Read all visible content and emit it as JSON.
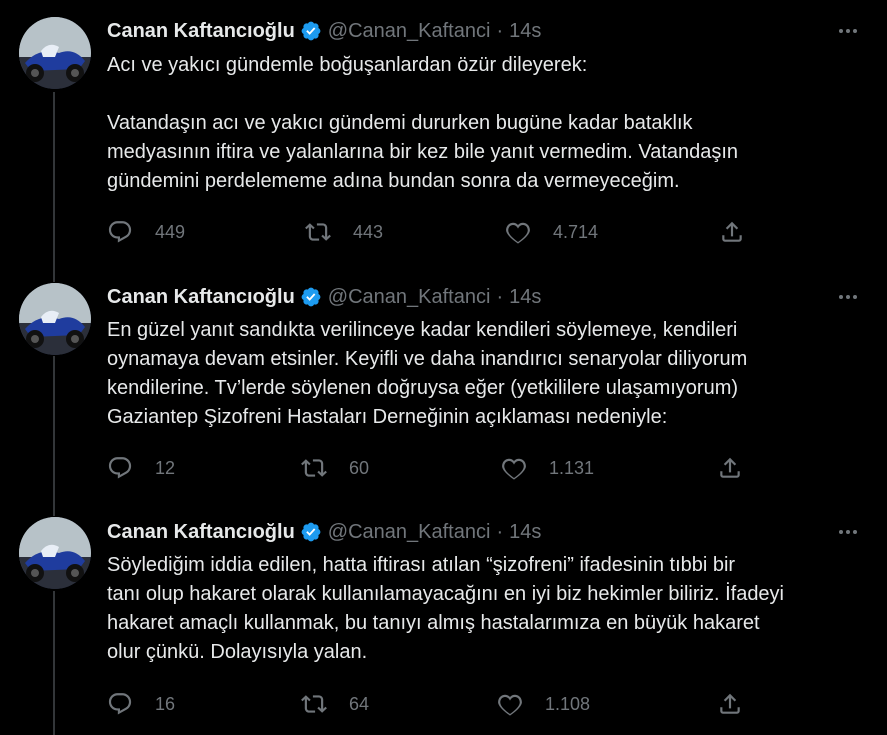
{
  "tweets": [
    {
      "author": "Canan Kaftancıoğlu",
      "handle": "@Canan_Kaftanci",
      "separator": "·",
      "time": "14s",
      "text": "Acı ve yakıcı gündemle boğuşanlardan özür dileyerek:\n\nVatandaşın acı ve yakıcı gündemi dururken bugüne kadar bataklık\nmedyasının iftira ve yalanlarına bir kez bile yanıt vermedim. Vatandaşın\ngündemini perdelememe adına bundan sonra da vermeyeceğim.",
      "replies": "449",
      "retweets": "443",
      "likes": "4.714"
    },
    {
      "author": "Canan Kaftancıoğlu",
      "handle": "@Canan_Kaftanci",
      "separator": "·",
      "time": "14s",
      "text": "En güzel yanıt sandıkta verilinceye kadar kendileri söylemeye, kendileri\noynamaya devam etsinler. Keyifli ve daha inandırıcı senaryolar diliyorum\nkendilerine. Tv’lerde söylenen doğruysa eğer (yetkililere ulaşamıyorum)\nGaziantep Şizofreni Hastaları Derneğinin açıklaması nedeniyle:",
      "replies": "12",
      "retweets": "60",
      "likes": "1.131"
    },
    {
      "author": "Canan Kaftancıoğlu",
      "handle": "@Canan_Kaftanci",
      "separator": "·",
      "time": "14s",
      "text": "Söylediğim iddia edilen, hatta iftirası atılan “şizofreni” ifadesinin tıbbi bir\ntanı olup hakaret olarak kullanılamayacağını en iyi biz hekimler biliriz. İfadeyi\nhakaret amaçlı kullanmak, bu tanıyı almış hastalarımıza en büyük hakaret\nolur çünkü. Dolayısıyla yalan.",
      "replies": "16",
      "retweets": "64",
      "likes": "1.108"
    }
  ],
  "colors": {
    "background": "#000000",
    "text": "#e7e9ea",
    "muted": "#71767b",
    "verified": "#1d9bf0",
    "thread_line": "#333639"
  },
  "icons": {
    "reply": "reply-icon",
    "retweet": "retweet-icon",
    "like": "like-icon",
    "share": "share-icon",
    "more": "more-icon",
    "verified": "verified-badge-icon"
  }
}
